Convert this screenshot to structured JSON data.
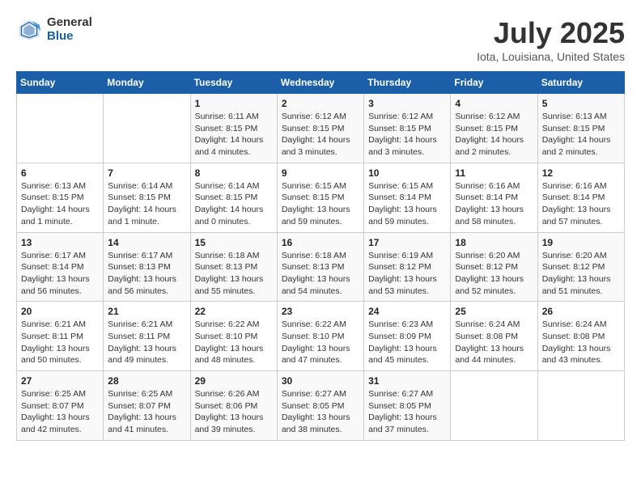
{
  "logo": {
    "general": "General",
    "blue": "Blue"
  },
  "header": {
    "month_year": "July 2025",
    "location": "Iota, Louisiana, United States"
  },
  "days_of_week": [
    "Sunday",
    "Monday",
    "Tuesday",
    "Wednesday",
    "Thursday",
    "Friday",
    "Saturday"
  ],
  "weeks": [
    [
      {
        "day": "",
        "info": ""
      },
      {
        "day": "",
        "info": ""
      },
      {
        "day": "1",
        "info": "Sunrise: 6:11 AM\nSunset: 8:15 PM\nDaylight: 14 hours and 4 minutes."
      },
      {
        "day": "2",
        "info": "Sunrise: 6:12 AM\nSunset: 8:15 PM\nDaylight: 14 hours and 3 minutes."
      },
      {
        "day": "3",
        "info": "Sunrise: 6:12 AM\nSunset: 8:15 PM\nDaylight: 14 hours and 3 minutes."
      },
      {
        "day": "4",
        "info": "Sunrise: 6:12 AM\nSunset: 8:15 PM\nDaylight: 14 hours and 2 minutes."
      },
      {
        "day": "5",
        "info": "Sunrise: 6:13 AM\nSunset: 8:15 PM\nDaylight: 14 hours and 2 minutes."
      }
    ],
    [
      {
        "day": "6",
        "info": "Sunrise: 6:13 AM\nSunset: 8:15 PM\nDaylight: 14 hours and 1 minute."
      },
      {
        "day": "7",
        "info": "Sunrise: 6:14 AM\nSunset: 8:15 PM\nDaylight: 14 hours and 1 minute."
      },
      {
        "day": "8",
        "info": "Sunrise: 6:14 AM\nSunset: 8:15 PM\nDaylight: 14 hours and 0 minutes."
      },
      {
        "day": "9",
        "info": "Sunrise: 6:15 AM\nSunset: 8:15 PM\nDaylight: 13 hours and 59 minutes."
      },
      {
        "day": "10",
        "info": "Sunrise: 6:15 AM\nSunset: 8:14 PM\nDaylight: 13 hours and 59 minutes."
      },
      {
        "day": "11",
        "info": "Sunrise: 6:16 AM\nSunset: 8:14 PM\nDaylight: 13 hours and 58 minutes."
      },
      {
        "day": "12",
        "info": "Sunrise: 6:16 AM\nSunset: 8:14 PM\nDaylight: 13 hours and 57 minutes."
      }
    ],
    [
      {
        "day": "13",
        "info": "Sunrise: 6:17 AM\nSunset: 8:14 PM\nDaylight: 13 hours and 56 minutes."
      },
      {
        "day": "14",
        "info": "Sunrise: 6:17 AM\nSunset: 8:13 PM\nDaylight: 13 hours and 56 minutes."
      },
      {
        "day": "15",
        "info": "Sunrise: 6:18 AM\nSunset: 8:13 PM\nDaylight: 13 hours and 55 minutes."
      },
      {
        "day": "16",
        "info": "Sunrise: 6:18 AM\nSunset: 8:13 PM\nDaylight: 13 hours and 54 minutes."
      },
      {
        "day": "17",
        "info": "Sunrise: 6:19 AM\nSunset: 8:12 PM\nDaylight: 13 hours and 53 minutes."
      },
      {
        "day": "18",
        "info": "Sunrise: 6:20 AM\nSunset: 8:12 PM\nDaylight: 13 hours and 52 minutes."
      },
      {
        "day": "19",
        "info": "Sunrise: 6:20 AM\nSunset: 8:12 PM\nDaylight: 13 hours and 51 minutes."
      }
    ],
    [
      {
        "day": "20",
        "info": "Sunrise: 6:21 AM\nSunset: 8:11 PM\nDaylight: 13 hours and 50 minutes."
      },
      {
        "day": "21",
        "info": "Sunrise: 6:21 AM\nSunset: 8:11 PM\nDaylight: 13 hours and 49 minutes."
      },
      {
        "day": "22",
        "info": "Sunrise: 6:22 AM\nSunset: 8:10 PM\nDaylight: 13 hours and 48 minutes."
      },
      {
        "day": "23",
        "info": "Sunrise: 6:22 AM\nSunset: 8:10 PM\nDaylight: 13 hours and 47 minutes."
      },
      {
        "day": "24",
        "info": "Sunrise: 6:23 AM\nSunset: 8:09 PM\nDaylight: 13 hours and 45 minutes."
      },
      {
        "day": "25",
        "info": "Sunrise: 6:24 AM\nSunset: 8:08 PM\nDaylight: 13 hours and 44 minutes."
      },
      {
        "day": "26",
        "info": "Sunrise: 6:24 AM\nSunset: 8:08 PM\nDaylight: 13 hours and 43 minutes."
      }
    ],
    [
      {
        "day": "27",
        "info": "Sunrise: 6:25 AM\nSunset: 8:07 PM\nDaylight: 13 hours and 42 minutes."
      },
      {
        "day": "28",
        "info": "Sunrise: 6:25 AM\nSunset: 8:07 PM\nDaylight: 13 hours and 41 minutes."
      },
      {
        "day": "29",
        "info": "Sunrise: 6:26 AM\nSunset: 8:06 PM\nDaylight: 13 hours and 39 minutes."
      },
      {
        "day": "30",
        "info": "Sunrise: 6:27 AM\nSunset: 8:05 PM\nDaylight: 13 hours and 38 minutes."
      },
      {
        "day": "31",
        "info": "Sunrise: 6:27 AM\nSunset: 8:05 PM\nDaylight: 13 hours and 37 minutes."
      },
      {
        "day": "",
        "info": ""
      },
      {
        "day": "",
        "info": ""
      }
    ]
  ]
}
